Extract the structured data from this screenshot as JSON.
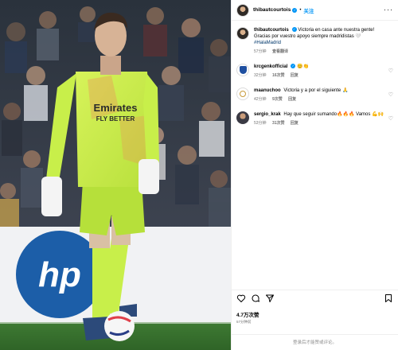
{
  "post": {
    "author": "thibautcourtois",
    "follow_label": "关注",
    "separator": "•",
    "caption": {
      "user": "thibautcourtois",
      "text": "Victoria en casa ante nuestra gente! Gracias por vuestro apoyo siempre madridistas 🤍",
      "hashtag": "#HalaMadrid",
      "time": "57分钟",
      "translate": "查看翻译"
    },
    "comments": [
      {
        "user": "krcgenkofficial",
        "text": "😊👏",
        "time": "32分钟",
        "likes": "16次赞",
        "reply": "回复"
      },
      {
        "user": "maanuchoo",
        "text": "Victoria y a por el siguiente 🙏",
        "time": "42分钟",
        "likes": "9次赞",
        "reply": "回复"
      },
      {
        "user": "sergio_krak",
        "text": "Hay que seguir sumando🔥🔥🔥 Vamos 💪🙌",
        "time": "53分钟",
        "likes": "31次赞",
        "reply": "回复"
      }
    ],
    "likes": "4.7万次赞",
    "date": "57分钟前",
    "login_prompt": "登录后才能赞或评论。"
  },
  "photo": {
    "jersey_sponsor_1": "Emirates",
    "jersey_sponsor_2": "FLY BETTER",
    "board_logo": "hp"
  },
  "icons": {
    "more": "more-horizontal-icon",
    "like": "heart-icon",
    "comment": "comment-icon",
    "share": "share-icon",
    "save": "bookmark-icon"
  },
  "colors": {
    "accent": "#0095f6",
    "jersey": "#c8ef4a",
    "board": "#1c5ea8"
  }
}
